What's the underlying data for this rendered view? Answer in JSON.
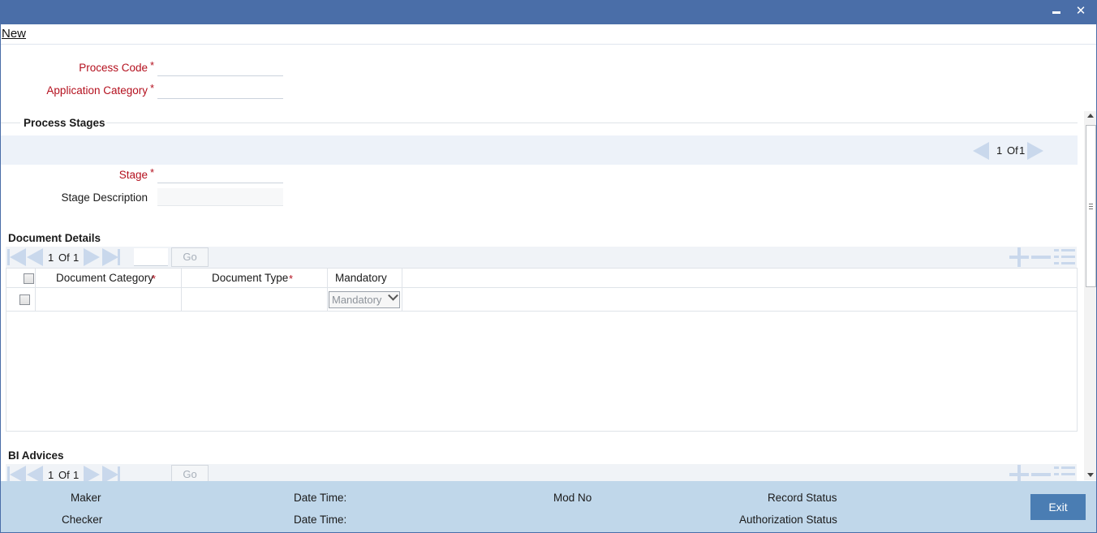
{
  "menu": {
    "new_label": "New"
  },
  "form": {
    "process_code": {
      "label": "Process Code",
      "value": ""
    },
    "application_category": {
      "label": "Application Category",
      "value": ""
    }
  },
  "process_stages": {
    "title": "Process Stages",
    "pager": {
      "current": "1",
      "of_label": "Of",
      "total": "1"
    },
    "stage": {
      "label": "Stage",
      "value": ""
    },
    "stage_description": {
      "label": "Stage Description",
      "value": ""
    }
  },
  "document_details": {
    "title": "Document Details",
    "pager": {
      "current": "1",
      "of_label": "Of",
      "total": "1",
      "go_label": "Go"
    },
    "columns": [
      "Document Category",
      "Document Type",
      "Mandatory"
    ],
    "rows": [
      {
        "document_category": "",
        "document_type": "",
        "mandatory": "Mandatory"
      }
    ]
  },
  "bi_advices": {
    "title": "BI Advices",
    "pager": {
      "current": "1",
      "of_label": "Of",
      "total": "1",
      "go_label": "Go"
    }
  },
  "footer": {
    "maker_label": "Maker",
    "checker_label": "Checker",
    "date_time_label": "Date Time:",
    "mod_no_label": "Mod No",
    "record_status_label": "Record Status",
    "authorization_status_label": "Authorization Status",
    "exit_label": "Exit"
  },
  "colors": {
    "titlebar": "#4a6ea8",
    "footer": "#c0d7ea",
    "required": "#b4101e",
    "exit_button": "#4a7db3"
  }
}
